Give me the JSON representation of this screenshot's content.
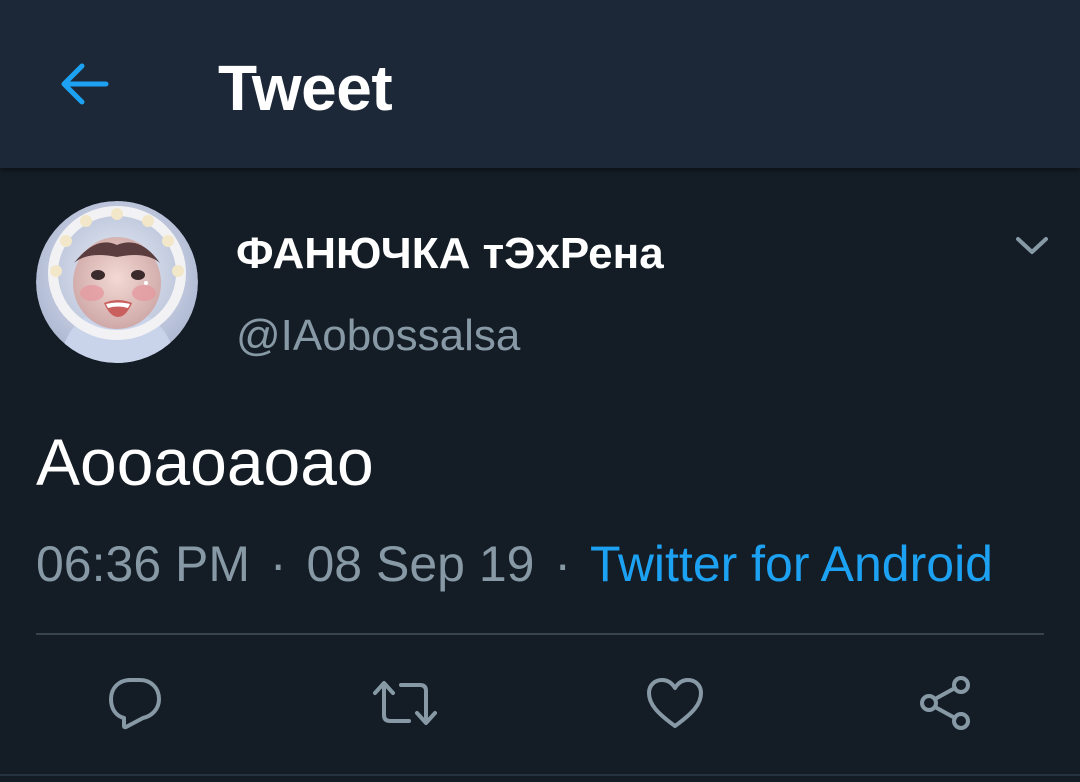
{
  "header": {
    "title": "Tweet",
    "back_icon": "arrow-left-icon"
  },
  "tweet": {
    "display_name": "ФАНЮЧКА тЭхРена",
    "username": "@IAobossalsa",
    "text": "Аооаоаоао",
    "time": "06:36 PM",
    "separator": "·",
    "date": "08 Sep 19",
    "source": "Twitter for Android",
    "caret_icon": "chevron-down-icon"
  },
  "actions": [
    {
      "icon": "reply-icon"
    },
    {
      "icon": "retweet-icon"
    },
    {
      "icon": "heart-icon"
    },
    {
      "icon": "share-icon"
    }
  ],
  "colors": {
    "background": "#141d26",
    "header": "#1c2838",
    "accent": "#1da1f2",
    "muted": "#8899a6",
    "divider": "#38444d"
  }
}
